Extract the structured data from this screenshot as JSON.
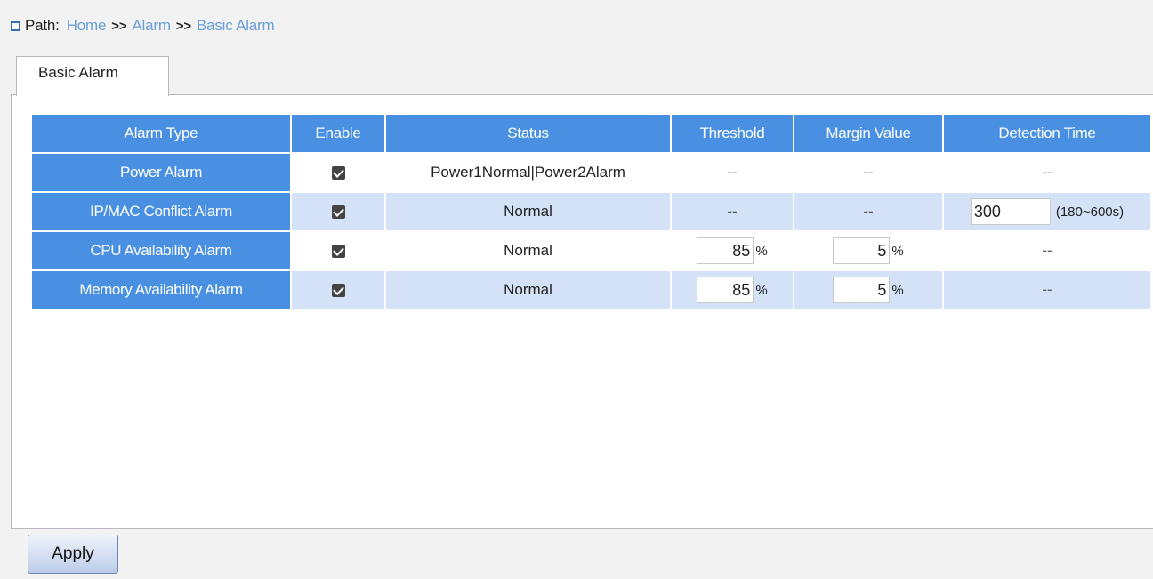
{
  "breadcrumb": {
    "label": "Path:",
    "items": [
      "Home",
      "Alarm",
      "Basic Alarm"
    ],
    "separator": ">>"
  },
  "tab": {
    "label": "Basic Alarm"
  },
  "table": {
    "headers": [
      "Alarm Type",
      "Enable",
      "Status",
      "Threshold",
      "Margin Value",
      "Detection Time"
    ],
    "rows": [
      {
        "type": "Power Alarm",
        "enabled": true,
        "status": "Power1Normal|Power2Alarm",
        "threshold": "--",
        "margin": "--",
        "detection": "--"
      },
      {
        "type": "IP/MAC Conflict Alarm",
        "enabled": true,
        "status": "Normal",
        "threshold": "--",
        "margin": "--",
        "detection_value": "300",
        "detection_range": "(180~600s)"
      },
      {
        "type": "CPU Availability Alarm",
        "enabled": true,
        "status": "Normal",
        "threshold_value": "85",
        "threshold_unit": "%",
        "margin_value": "5",
        "margin_unit": "%",
        "detection": "--"
      },
      {
        "type": "Memory Availability Alarm",
        "enabled": true,
        "status": "Normal",
        "threshold_value": "85",
        "threshold_unit": "%",
        "margin_value": "5",
        "margin_unit": "%",
        "detection": "--"
      }
    ]
  },
  "buttons": {
    "apply": "Apply"
  },
  "colors": {
    "header_bg": "#4a90e2",
    "row_alt_bg": "#d3e2f7",
    "link": "#6b9fd6"
  },
  "icons": {
    "breadcrumb_marker": "square-icon",
    "checkbox": "checkbox-checked-icon"
  }
}
